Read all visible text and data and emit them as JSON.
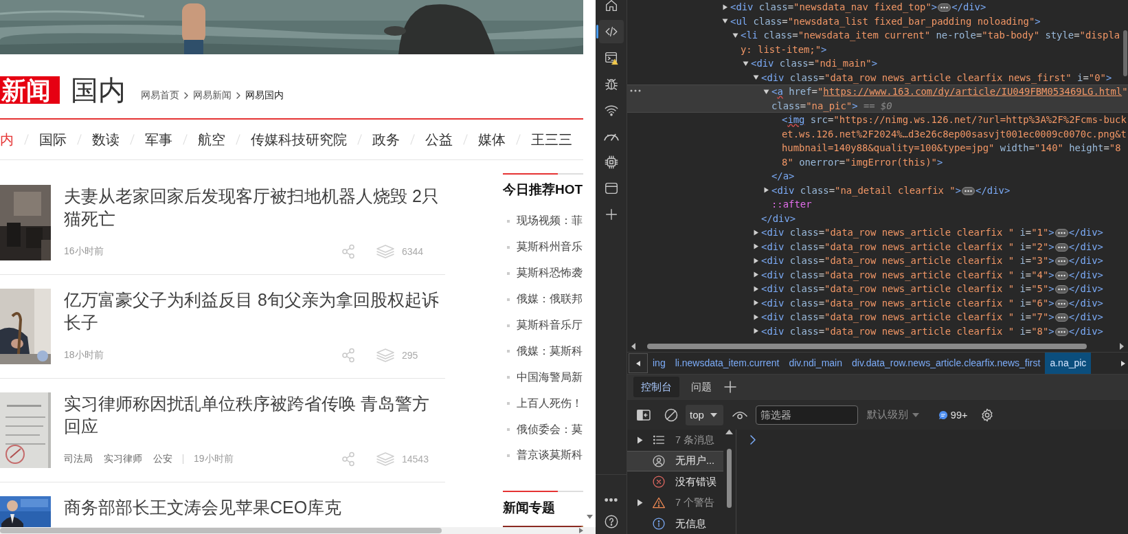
{
  "browser_page": {
    "header": {
      "logo": "新闻",
      "channel": "国内",
      "breadcrumb": [
        {
          "label": "网易首页",
          "selected": false
        },
        {
          "label": "网易新闻",
          "selected": false
        },
        {
          "label": "网易国内",
          "selected": true
        }
      ]
    },
    "nav": [
      {
        "label": "内",
        "selected": true
      },
      {
        "label": "国际",
        "selected": false
      },
      {
        "label": "数读",
        "selected": false
      },
      {
        "label": "军事",
        "selected": false
      },
      {
        "label": "航空",
        "selected": false
      },
      {
        "label": "传媒科技研究院",
        "selected": false
      },
      {
        "label": "政务",
        "selected": false
      },
      {
        "label": "公益",
        "selected": false
      },
      {
        "label": "媒体",
        "selected": false
      },
      {
        "label": "王三三",
        "selected": false
      }
    ],
    "articles": [
      {
        "title": "夫妻从老家回家后发现客厅被扫地机器人烧毁 2只猫死亡",
        "time": "16小时前",
        "count": "6344"
      },
      {
        "title": "亿万富豪父子为利益反目 8旬父亲为拿回股权起诉长子",
        "time": "18小时前",
        "count": "295"
      },
      {
        "title": "实习律师称因扰乱单位秩序被跨省传唤 青岛警方回应",
        "tags": [
          "司法局",
          "实习律师",
          "公安"
        ],
        "time": "19小时前",
        "count": "14543"
      },
      {
        "title": "商务部部长王文涛会见苹果CEO库克"
      }
    ],
    "sidebar": {
      "title": "今日推荐HOT",
      "items": [
        "现场视频：菲",
        "莫斯科州音乐",
        "莫斯科恐怖袭",
        "俄媒：俄联邦",
        "莫斯科音乐厅",
        "俄媒：莫斯科",
        "中国海警局新",
        "上百人死伤！",
        "俄侦委会：莫",
        "普京谈莫斯科"
      ]
    },
    "sidebar_2": {
      "title": "新闻专题"
    }
  },
  "devtools": {
    "activity_bar": [
      {
        "kind": "welcome",
        "selected": false,
        "warning": false
      },
      {
        "kind": "elements",
        "selected": true,
        "warning": false
      },
      {
        "kind": "console",
        "selected": false,
        "warning": true
      },
      {
        "kind": "sources",
        "selected": false,
        "warning": false
      },
      {
        "kind": "network",
        "selected": false,
        "warning": false
      },
      {
        "kind": "performance",
        "selected": false,
        "warning": false
      },
      {
        "kind": "memory",
        "selected": false,
        "warning": false
      },
      {
        "kind": "application",
        "selected": false,
        "warning": false
      },
      {
        "kind": "more_tools",
        "selected": false,
        "warning": false
      }
    ],
    "activity_bar_bottom": [
      {
        "kind": "more"
      },
      {
        "kind": "help"
      }
    ],
    "dom_tree": [
      {
        "open": "<div class=\"newsdata_nav fixed_top\">",
        "close": "</div>",
        "expanded": false,
        "selected": false
      },
      {
        "open": "<ul class=\"newsdata_list fixed_bar_padding noloading\">",
        "expanded": true,
        "selected": false,
        "children": [
          {
            "open": "<li class=\"newsdata_item current\" ne-role=\"tab-body\" style=\"display: list-item;\">",
            "expanded": true,
            "selected": false,
            "children": [
              {
                "open": "<div class=\"ndi_main\">",
                "expanded": true,
                "selected": false,
                "children": [
                  {
                    "open": "<div class=\"data_row news_article clearfix news_first\" i=\"0\">",
                    "close": "</div>",
                    "expanded": true,
                    "selected": false,
                    "children": [
                      {
                        "open": "<a href=\"https://www.163.com/dy/article/IU049FBM053469LG.html\" class=\"na_pic\">",
                        "close": "</a>",
                        "expanded": true,
                        "selected": true,
                        "issue": true,
                        "link": true,
                        "suffix": "== $0",
                        "children": [
                          {
                            "open": "<img src=\"https://nimg.ws.126.net/?url=http%3A%2F%2Fcms-bucket.ws.126.net%2F2024%…d3e26c8ep00sasvjt001ec0009c0070c.png&thumbnail=140y88&quality=100&type=jpg\" width=\"140\" height=\"88\" onerror=\"imgError(this)\">",
                            "issue": true
                          }
                        ]
                      },
                      {
                        "open": "<div class=\"na_detail clearfix \">",
                        "close": "</div>",
                        "expanded": false,
                        "selected": false
                      },
                      {
                        "kind": "pseudo",
                        "open": "::after"
                      }
                    ]
                  },
                  {
                    "open": "<div class=\"data_row news_article clearfix \" i=\"1\">",
                    "close": "</div>",
                    "expanded": false,
                    "selected": false
                  },
                  {
                    "open": "<div class=\"data_row news_article clearfix \" i=\"2\">",
                    "close": "</div>",
                    "expanded": false,
                    "selected": false
                  },
                  {
                    "open": "<div class=\"data_row news_article clearfix \" i=\"3\">",
                    "close": "</div>",
                    "expanded": false,
                    "selected": false
                  },
                  {
                    "open": "<div class=\"data_row news_article clearfix \" i=\"4\">",
                    "close": "</div>",
                    "expanded": false,
                    "selected": false
                  },
                  {
                    "open": "<div class=\"data_row news_article clearfix \" i=\"5\">",
                    "close": "</div>",
                    "expanded": false,
                    "selected": false
                  },
                  {
                    "open": "<div class=\"data_row news_article clearfix \" i=\"6\">",
                    "close": "</div>",
                    "expanded": false,
                    "selected": false
                  },
                  {
                    "open": "<div class=\"data_row news_article clearfix \" i=\"7\">",
                    "close": "</div>",
                    "expanded": false,
                    "selected": false
                  },
                  {
                    "open": "<div class=\"data_row news_article clearfix \" i=\"8\">",
                    "close": "</div>",
                    "expanded": false,
                    "selected": false
                  }
                ]
              }
            ]
          }
        ]
      }
    ],
    "breadcrumbs": [
      {
        "label": "ing",
        "selected": false
      },
      {
        "label": "li.newsdata_item.current",
        "selected": false
      },
      {
        "label": "div.ndi_main",
        "selected": false
      },
      {
        "label": "div.data_row.news_article.clearfix.news_first",
        "selected": false
      },
      {
        "label": "a.na_pic",
        "selected": true
      }
    ],
    "drawer_tabs": [
      {
        "label": "控制台",
        "selected": true
      },
      {
        "label": "问题",
        "selected": false
      }
    ],
    "console_toolbar": {
      "context": "top",
      "filter_placeholder": "筛选器",
      "level": "默认级别",
      "message_count": "99+"
    },
    "console_sidebar": [
      {
        "kind": "messages",
        "label": "7 条消息",
        "expandable": true,
        "selected": false
      },
      {
        "kind": "user",
        "label": "无用户...",
        "expandable": false,
        "selected": true
      },
      {
        "kind": "errors",
        "label": "没有错误",
        "expandable": false,
        "selected": false
      },
      {
        "kind": "warnings",
        "label": "7 个警告",
        "expandable": true,
        "selected": false
      },
      {
        "kind": "info",
        "label": "无信息",
        "expandable": false,
        "selected": false
      }
    ]
  }
}
